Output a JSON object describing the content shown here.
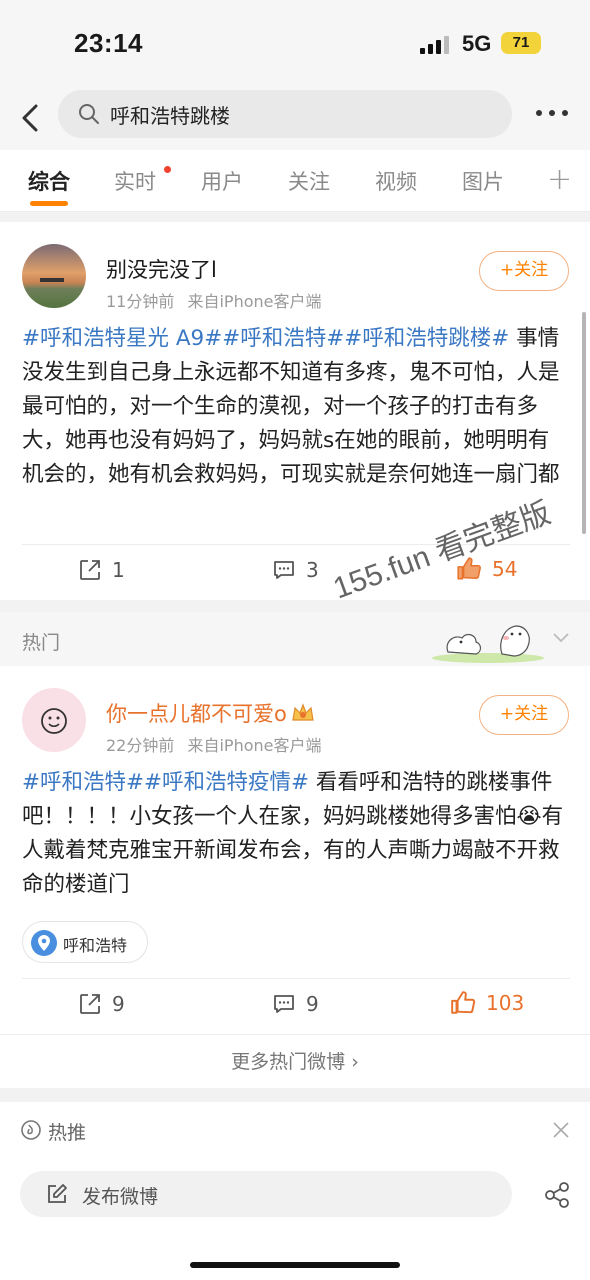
{
  "status_bar": {
    "time": "23:14",
    "network": "5G",
    "battery": "71"
  },
  "search": {
    "query": "呼和浩特跳楼"
  },
  "tabs": [
    {
      "label": "综合",
      "active": true
    },
    {
      "label": "实时",
      "active": false
    },
    {
      "label": "用户",
      "active": false
    },
    {
      "label": "关注",
      "active": false
    },
    {
      "label": "视频",
      "active": false
    },
    {
      "label": "图片",
      "active": false
    }
  ],
  "tab_plus": "+",
  "colors": {
    "accent": "#ff8200",
    "hashtag": "#3b78c4",
    "like_active": "#e8722c"
  },
  "post1": {
    "username": "别没完没了l",
    "time": "11分钟前",
    "source": "来自iPhone客户端",
    "follow_label": "+关注",
    "hashtags": "#呼和浩特星光 A9##呼和浩特##呼和浩特跳楼#",
    "body": " 事情没发生到自己身上永远都不知道有多疼，鬼不可怕，人是最可怕的，对一个生命的漠视，对一个孩子的打击有多大，她再也没有妈妈了，妈妈就s在她的眼前，她明明有机会的，她有机会救妈妈，可现实就是奈何她连一扇门都打不开......",
    "reposts": "1",
    "comments": "3",
    "likes": "54"
  },
  "hot_section": {
    "label": "热门"
  },
  "post2": {
    "username": "你一点儿都不可爱o",
    "time": "22分钟前",
    "source": "来自iPhone客户端",
    "follow_label": "+关注",
    "hashtags": "#呼和浩特##呼和浩特疫情#",
    "body": " 看看呼和浩特的跳楼事件吧！！！！小女孩一个人在家，妈妈跳楼她得多害怕😭有人戴着梵克雅宝开新闻发布会，有的人声嘶力竭敲不开救命的楼道门",
    "location": "呼和浩特",
    "reposts": "9",
    "comments": "9",
    "likes": "103"
  },
  "more_hot": "更多热门微博 ›",
  "hot_push": {
    "label": "热推"
  },
  "compose": {
    "label": "发布微博"
  },
  "watermark": "155.fun 看完整版"
}
